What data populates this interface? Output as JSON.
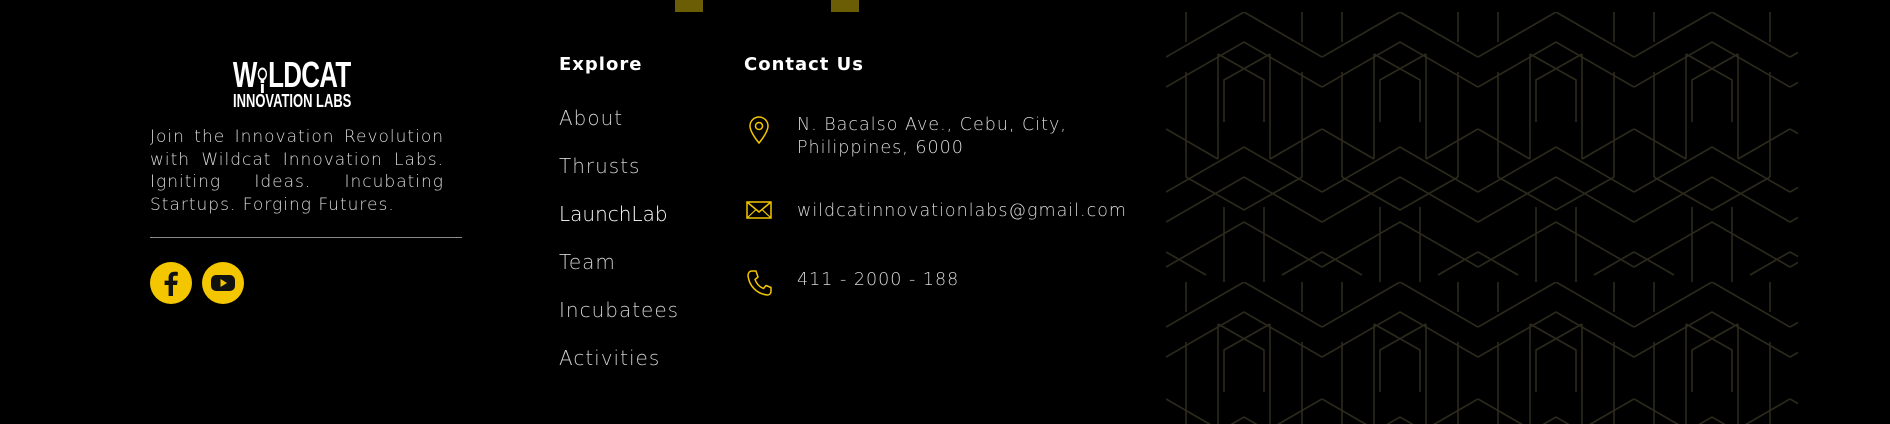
{
  "brand": {
    "logo_word_left": "W",
    "logo_word_right": "LDCAT",
    "logo_sub": "INNOVATION LABS",
    "tagline": "Join the Innovation Revolution with Wildcat Innovation Labs. Igniting Ideas. Incubating Startups. Forging Futures.",
    "socials": [
      {
        "name": "facebook-icon"
      },
      {
        "name": "youtube-icon"
      }
    ]
  },
  "explore": {
    "heading": "Explore",
    "items": [
      {
        "label": "About"
      },
      {
        "label": "Thrusts"
      },
      {
        "label": "LaunchLab"
      },
      {
        "label": "Team"
      },
      {
        "label": "Incubatees"
      },
      {
        "label": "Activities"
      }
    ]
  },
  "contact": {
    "heading": "Contact Us",
    "address_line1": "N. Bacalso Ave., Cebu, City,",
    "address_line2": "Philippines, 6000",
    "email": "wildcatinnovationlabs@gmail.com",
    "phone": "411 - 2000 - 188"
  },
  "colors": {
    "accent": "#f3c600",
    "background": "#000000",
    "pattern_stroke": "#2c2a1c",
    "top_block": "#6b5d05"
  },
  "icons": [
    "location-pin-icon",
    "envelope-icon",
    "phone-icon",
    "facebook-icon",
    "youtube-icon"
  ]
}
